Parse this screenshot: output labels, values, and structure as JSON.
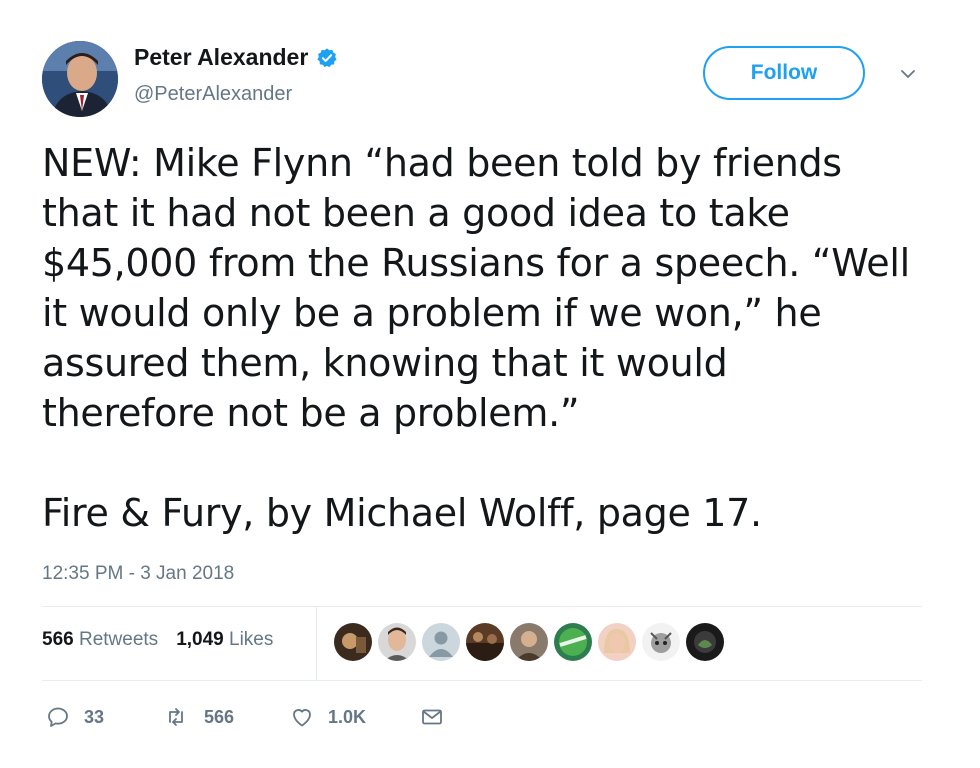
{
  "author": {
    "name": "Peter Alexander",
    "handle": "@PeterAlexander",
    "verified": true
  },
  "follow_label": "Follow",
  "tweet": {
    "paragraph1": "NEW: Mike Flynn “had been told by friends\nthat it had not been a good idea to take\n$45,000 from the Russians for a speech. “Well\nit would only be a problem if we won,” he\nassured them, knowing that it would\ntherefore not be a problem.”",
    "paragraph2": "Fire & Fury, by Michael Wolff, page 17."
  },
  "timestamp": "12:35 PM - 3 Jan 2018",
  "stats": {
    "retweets_count": "566",
    "retweets_label": "Retweets",
    "likes_count": "1,049",
    "likes_label": "Likes"
  },
  "actions": {
    "replies": "33",
    "retweets": "566",
    "likes": "1.0K"
  },
  "colors": {
    "accent": "#1da1f2",
    "muted": "#657786",
    "divider": "#e6ecf0"
  }
}
